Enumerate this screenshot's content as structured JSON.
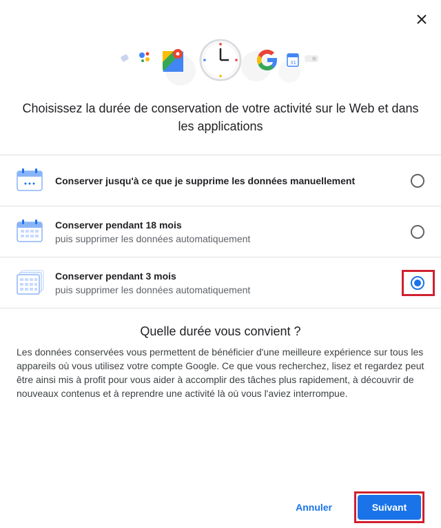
{
  "dialog": {
    "title": "Choisissez la durée de conservation de votre activité sur le Web et dans les applications",
    "close_icon": "close-icon"
  },
  "options": [
    {
      "title": "Conserver jusqu'à ce que je supprime les données manuellement",
      "subtitle": "",
      "selected": false,
      "icon": "calendar-icon"
    },
    {
      "title": "Conserver pendant 18 mois",
      "subtitle": "puis supprimer les données automatiquement",
      "selected": false,
      "icon": "calendar-icon"
    },
    {
      "title": "Conserver pendant 3 mois",
      "subtitle": "puis supprimer les données automatiquement",
      "selected": true,
      "icon": "calendar-stack-icon"
    }
  ],
  "info": {
    "heading": "Quelle durée vous convient ?",
    "body": "Les données conservées vous permettent de bénéficier d'une meilleure expérience sur tous les appareils où vous utilisez votre compte Google. Ce que vous recherchez, lisez et regardez peut être ainsi mis à profit pour vous aider à accomplir des tâches plus rapidement, à découvrir de nouveaux contenus et à reprendre une activité là où vous l'aviez interrompue."
  },
  "footer": {
    "cancel_label": "Annuler",
    "next_label": "Suivant"
  },
  "colors": {
    "accent": "#1a73e8",
    "highlight": "#d0202e"
  }
}
